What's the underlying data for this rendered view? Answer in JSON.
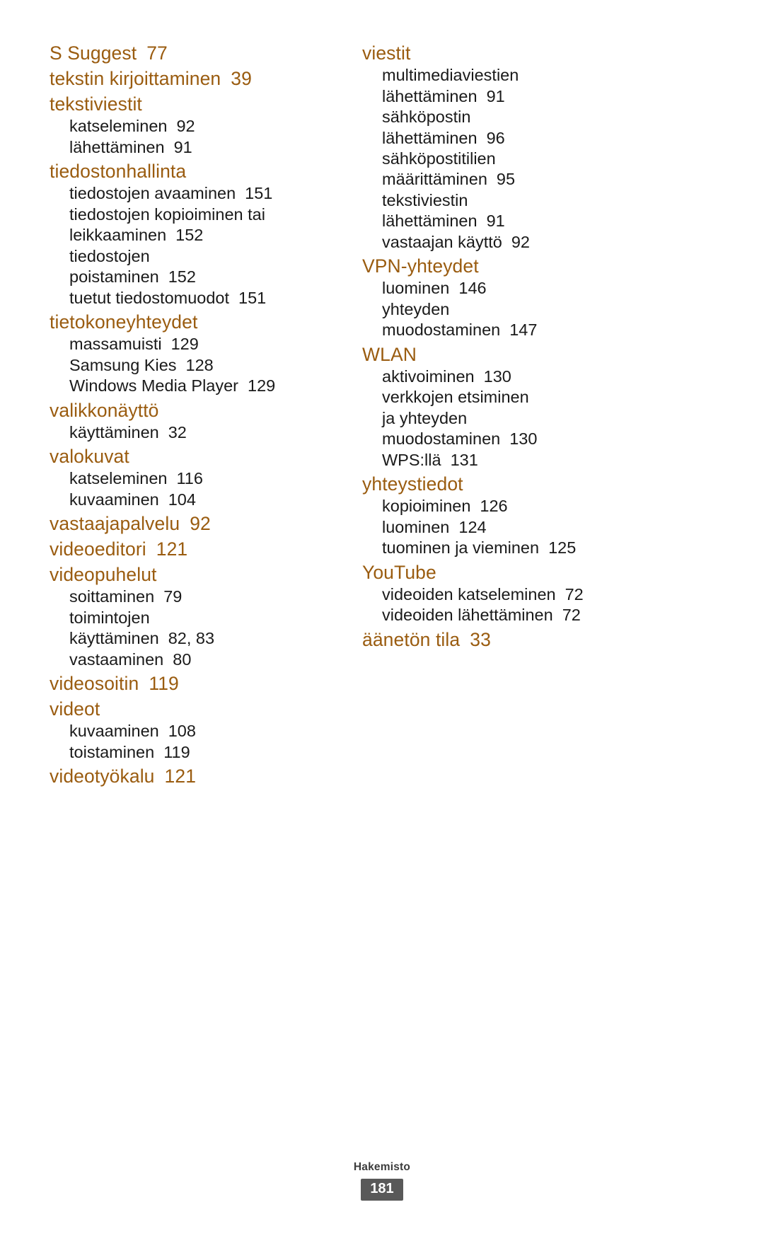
{
  "document": {
    "language": "fi",
    "accent_color": "#9a5c10",
    "body_color": "#1a1a1a",
    "badge_color": "#595959"
  },
  "footer": {
    "label": "Hakemisto",
    "page_number": "181"
  },
  "left_column": [
    {
      "head": "S Suggest",
      "head_page": "77",
      "subs": []
    },
    {
      "head": "tekstin kirjoittaminen",
      "head_page": "39",
      "subs": []
    },
    {
      "head": "tekstiviestit",
      "head_page": "",
      "subs": [
        {
          "label": "katseleminen",
          "page": "92"
        },
        {
          "label": "lähettäminen",
          "page": "91"
        }
      ]
    },
    {
      "head": "tiedostonhallinta",
      "head_page": "",
      "subs": [
        {
          "label": "tiedostojen avaaminen",
          "page": "151"
        },
        {
          "label": "tiedostojen kopioiminen tai",
          "page": ""
        },
        {
          "label": "leikkaaminen",
          "page": "152"
        },
        {
          "label": "tiedostojen",
          "page": ""
        },
        {
          "label": "poistaminen",
          "page": "152"
        },
        {
          "label": "tuetut tiedostomuodot",
          "page": "151"
        }
      ]
    },
    {
      "head": "tietokoneyhteydet",
      "head_page": "",
      "subs": [
        {
          "label": "massamuisti",
          "page": "129"
        },
        {
          "label": "Samsung Kies",
          "page": "128"
        },
        {
          "label": "Windows Media Player",
          "page": "129"
        }
      ]
    },
    {
      "head": "valikkonäyttö",
      "head_page": "",
      "subs": [
        {
          "label": "käyttäminen",
          "page": "32"
        }
      ]
    },
    {
      "head": "valokuvat",
      "head_page": "",
      "subs": [
        {
          "label": "katseleminen",
          "page": "116"
        },
        {
          "label": "kuvaaminen",
          "page": "104"
        }
      ]
    },
    {
      "head": "vastaajapalvelu",
      "head_page": "92",
      "subs": []
    },
    {
      "head": "videoeditori",
      "head_page": "121",
      "subs": []
    },
    {
      "head": "videopuhelut",
      "head_page": "",
      "subs": [
        {
          "label": "soittaminen",
          "page": "79"
        },
        {
          "label": "toimintojen",
          "page": ""
        },
        {
          "label": "käyttäminen",
          "page": "82, 83"
        },
        {
          "label": "vastaaminen",
          "page": "80"
        }
      ]
    },
    {
      "head": "videosoitin",
      "head_page": "119",
      "subs": []
    },
    {
      "head": "videot",
      "head_page": "",
      "subs": [
        {
          "label": "kuvaaminen",
          "page": "108"
        },
        {
          "label": "toistaminen",
          "page": "119"
        }
      ]
    },
    {
      "head": "videotyökalu",
      "head_page": "121",
      "subs": []
    }
  ],
  "right_column": [
    {
      "head": "viestit",
      "head_page": "",
      "subs": [
        {
          "label": "multimediaviestien",
          "page": ""
        },
        {
          "label": "lähettäminen",
          "page": "91"
        },
        {
          "label": "sähköpostin",
          "page": ""
        },
        {
          "label": "lähettäminen",
          "page": "96"
        },
        {
          "label": "sähköpostitilien",
          "page": ""
        },
        {
          "label": "määrittäminen",
          "page": "95"
        },
        {
          "label": "tekstiviestin",
          "page": ""
        },
        {
          "label": "lähettäminen",
          "page": "91"
        },
        {
          "label": "vastaajan käyttö",
          "page": "92"
        }
      ]
    },
    {
      "head": "VPN-yhteydet",
      "head_page": "",
      "subs": [
        {
          "label": "luominen",
          "page": "146"
        },
        {
          "label": "yhteyden",
          "page": ""
        },
        {
          "label": "muodostaminen",
          "page": "147"
        }
      ]
    },
    {
      "head": "WLAN",
      "head_page": "",
      "subs": [
        {
          "label": "aktivoiminen",
          "page": "130"
        },
        {
          "label": "verkkojen etsiminen",
          "page": ""
        },
        {
          "label": "ja yhteyden",
          "page": ""
        },
        {
          "label": "muodostaminen",
          "page": "130"
        },
        {
          "label": "WPS:llä",
          "page": "131"
        }
      ]
    },
    {
      "head": "yhteystiedot",
      "head_page": "",
      "subs": [
        {
          "label": "kopioiminen",
          "page": "126"
        },
        {
          "label": "luominen",
          "page": "124"
        },
        {
          "label": "tuominen ja vieminen",
          "page": "125"
        }
      ]
    },
    {
      "head": "YouTube",
      "head_page": "",
      "subs": [
        {
          "label": "videoiden katseleminen",
          "page": "72"
        },
        {
          "label": "videoiden lähettäminen",
          "page": "72"
        }
      ]
    },
    {
      "head": "äänetön tila",
      "head_page": "33",
      "subs": []
    }
  ]
}
